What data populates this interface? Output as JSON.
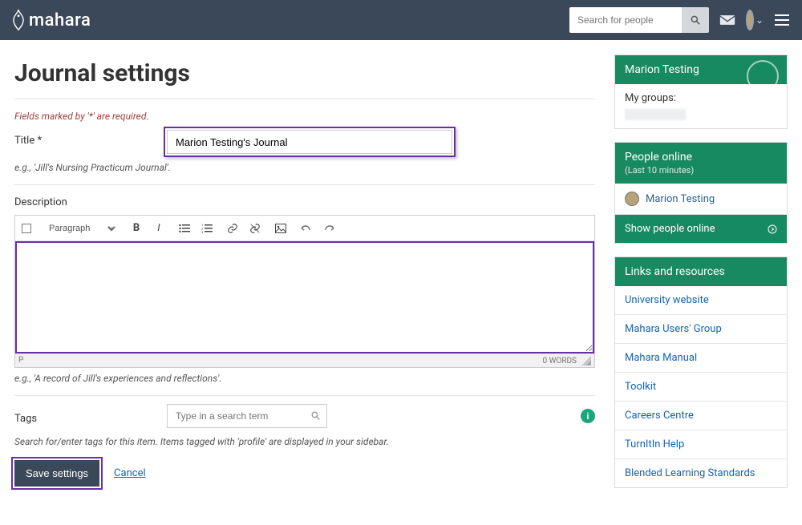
{
  "brand": "mahara",
  "search": {
    "placeholder": "Search for people"
  },
  "page_title": "Journal settings",
  "required_note": "Fields marked by '*' are required.",
  "title_field": {
    "label": "Title *",
    "value": "Marion Testing's Journal",
    "hint": "e.g., 'Jill's Nursing Practicum Journal'."
  },
  "description_field": {
    "label": "Description",
    "paragraph_label": "Paragraph",
    "path": "P",
    "word_count": "0 WORDS",
    "value": "",
    "hint": "e.g., 'A record of Jill's experiences and reflections'."
  },
  "tags_field": {
    "label": "Tags",
    "placeholder": "Type in a search term",
    "hint": "Search for/enter tags for this item. Items tagged with 'profile' are displayed in your sidebar."
  },
  "actions": {
    "save": "Save settings",
    "cancel": "Cancel"
  },
  "sidebar": {
    "user": {
      "name": "Marion Testing",
      "groups_label": "My groups:"
    },
    "online": {
      "title": "People online",
      "subtitle": "(Last 10 minutes)",
      "people": [
        "Marion Testing"
      ],
      "show_label": "Show people online"
    },
    "links": {
      "title": "Links and resources",
      "items": [
        "University website",
        "Mahara Users' Group",
        "Mahara Manual",
        "Toolkit",
        "Careers Centre",
        "TurnItIn Help",
        "Blended Learning Standards"
      ]
    }
  }
}
